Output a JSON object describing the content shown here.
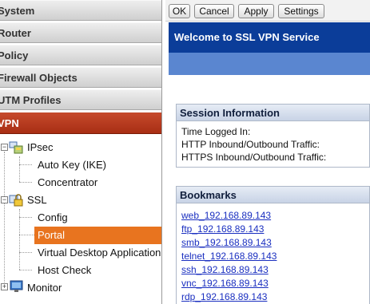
{
  "nav": {
    "sections": [
      {
        "label": "System"
      },
      {
        "label": "Router"
      },
      {
        "label": "Policy"
      },
      {
        "label": "Firewall Objects"
      },
      {
        "label": "UTM Profiles"
      },
      {
        "label": "VPN"
      }
    ],
    "tree": {
      "ipsec": {
        "label": "IPsec",
        "children": [
          "Auto Key (IKE)",
          "Concentrator"
        ]
      },
      "ssl": {
        "label": "SSL",
        "children": [
          "Config",
          "Portal",
          "Virtual Desktop Application",
          "Host Check"
        ]
      },
      "monitor": {
        "label": "Monitor"
      }
    },
    "selected": "Portal"
  },
  "toolbar": {
    "ok": "OK",
    "cancel": "Cancel",
    "apply": "Apply",
    "settings": "Settings"
  },
  "banner": {
    "title": "Welcome to SSL VPN Service"
  },
  "session": {
    "title": "Session Information",
    "lines": [
      "Time Logged In:",
      "HTTP Inbound/Outbound Traffic:",
      "HTTPS Inbound/Outbound Traffic:"
    ]
  },
  "bookmarks": {
    "title": "Bookmarks",
    "items": [
      "web_192.168.89.143",
      "ftp_192.168.89.143",
      "smb_192.168.89.143",
      "telnet_192.168.89.143",
      "ssh_192.168.89.143",
      "vnc_192.168.89.143",
      "rdp_192.168.89.143"
    ]
  },
  "colors": {
    "active_section": "#b43a1e",
    "selection": "#e8741f",
    "banner": "#0b3d99",
    "link": "#1a2fc0"
  },
  "icons": {
    "ipsec": "network-config-icon",
    "ssl": "ssl-lock-icon",
    "monitor": "monitor-icon"
  }
}
